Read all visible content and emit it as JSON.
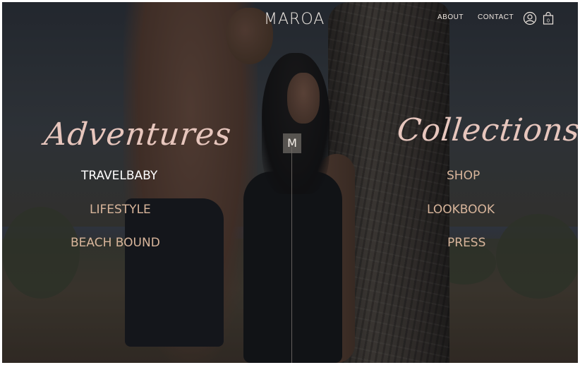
{
  "header": {
    "logo": "MAROA",
    "nav": [
      {
        "label": "ABOUT"
      },
      {
        "label": "CONTACT"
      }
    ],
    "icons": [
      "user-icon",
      "shopping-bag-icon"
    ],
    "cart_count": "0"
  },
  "center_badge": "M",
  "left_panel": {
    "heading": "Adventures",
    "links": [
      {
        "label": "TRAVELBABY"
      },
      {
        "label": "LIFESTYLE"
      },
      {
        "label": "BEACH BOUND"
      }
    ]
  },
  "right_panel": {
    "heading": "Collections",
    "links": [
      {
        "label": "SHOP"
      },
      {
        "label": "LOOKBOOK"
      },
      {
        "label": "PRESS"
      }
    ]
  },
  "colors": {
    "script_pink": "#e7c6bd",
    "link_tan": "#d8b59b",
    "active_link": "#ffffff"
  }
}
